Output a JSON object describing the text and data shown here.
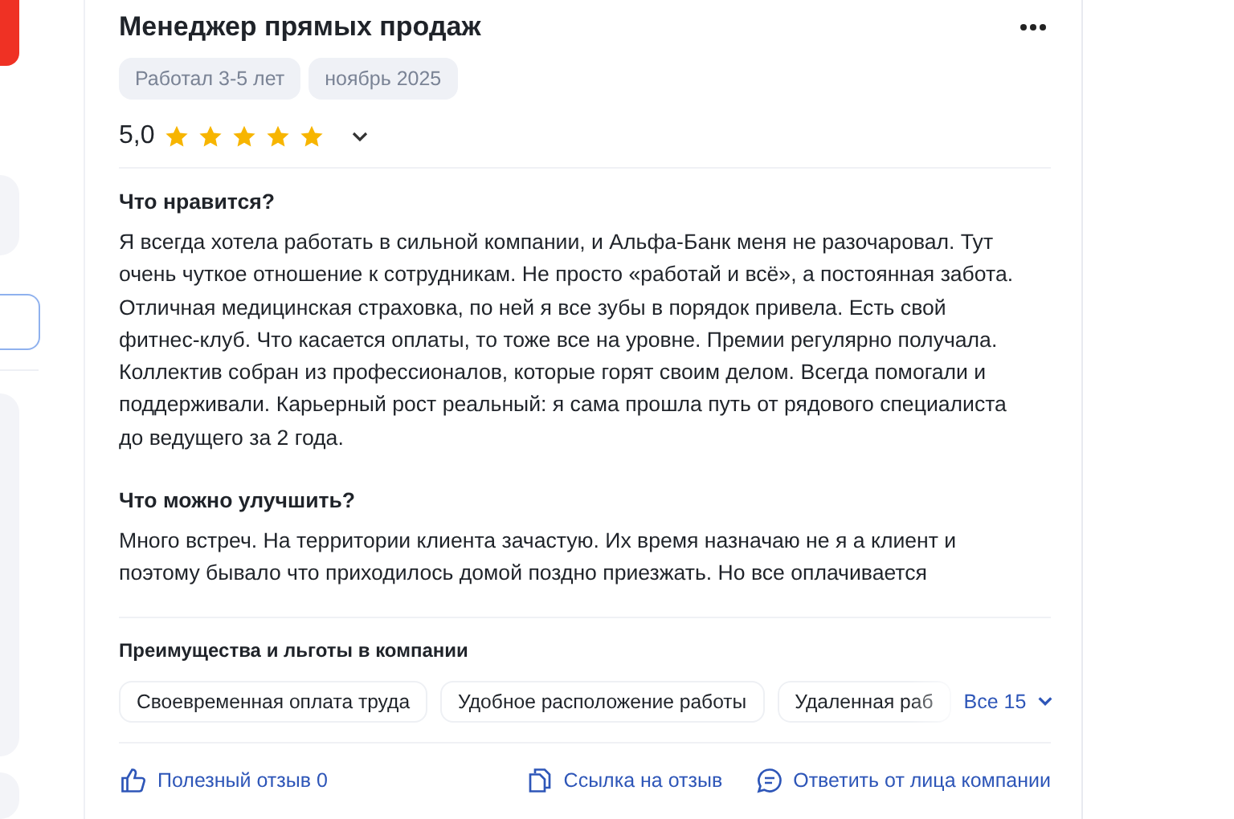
{
  "review": {
    "title": "Менеджер прямых продаж",
    "tags": [
      "Работал 3-5 лет",
      "ноябрь 2025"
    ],
    "rating": "5,0",
    "stars": 5,
    "sections": [
      {
        "heading": "Что нравится?",
        "lines": [
          "Я всегда хотела работать в сильной компании, и Альфа-Банк меня не разочаровал. Тут",
          "очень чуткое отношение к сотрудникам. Не просто «работай и всё», а постоянная забота.",
          "Отличная медицинская страховка, по ней я все зубы в порядок привела. Есть свой",
          "фитнес-клуб. Что касается оплаты, то тоже все на уровне. Премии регулярно получала.",
          "Коллектив собран из профессионалов, которые горят своим делом. Всегда помогали и",
          "поддерживали. Карьерный рост реальный: я сама прошла путь от рядового специалиста",
          "до ведущего за 2 года."
        ]
      },
      {
        "heading": "Что можно улучшить?",
        "lines": [
          "Много встреч. На территории клиента зачастую. Их время назначаю не я а клиент и",
          "поэтому бывало что приходилось домой поздно приезжать. Но все оплачивается"
        ]
      }
    ],
    "benefits": {
      "title": "Преимущества и льготы в компании",
      "items": [
        "Своевременная оплата труда",
        "Удобное расположение работы",
        "Удаленная раб"
      ],
      "more": "Все 15"
    },
    "actions": [
      {
        "kind": "like",
        "label": "Полезный отзыв 0"
      },
      {
        "kind": "link",
        "label": "Ссылка на отзыв"
      },
      {
        "kind": "reply",
        "label": "Ответить от лица компании"
      }
    ]
  }
}
